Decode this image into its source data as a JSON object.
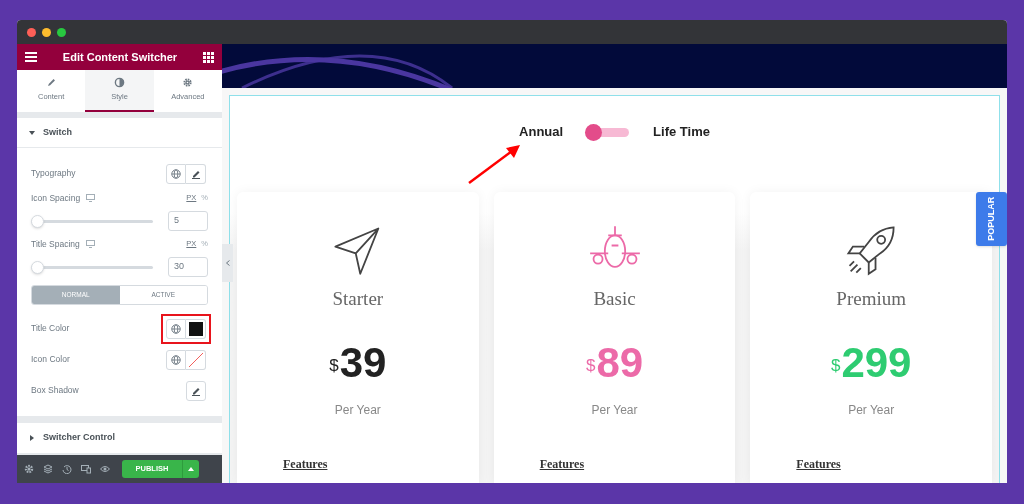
{
  "panel": {
    "title": "Edit Content Switcher",
    "tabs": [
      {
        "label": "Content",
        "selected": false
      },
      {
        "label": "Style",
        "selected": true
      },
      {
        "label": "Advanced",
        "selected": false
      }
    ],
    "sections": [
      {
        "title": "Switch",
        "expanded": true,
        "controls": [
          {
            "kind": "typography",
            "label": "Typography"
          },
          {
            "kind": "slider",
            "label": "Icon Spacing",
            "units": [
              "PX",
              "%"
            ],
            "level": 0,
            "value": "5"
          },
          {
            "kind": "slider",
            "label": "Title Spacing",
            "units": [
              "PX",
              "%"
            ],
            "level": 0,
            "value": "30"
          },
          {
            "kind": "state_tabs",
            "options": [
              {
                "label": "NORMAL",
                "selected": true
              },
              {
                "label": "ACTIVE",
                "selected": false
              }
            ]
          },
          {
            "kind": "color",
            "label": "Title Color",
            "color": "#111111",
            "highlighted": true
          },
          {
            "kind": "color",
            "label": "Icon Color",
            "highlighted": false
          },
          {
            "kind": "shadow",
            "label": "Box Shadow"
          }
        ]
      },
      {
        "title": "Switcher Control",
        "expanded": false
      }
    ],
    "publish": "PUBLISH"
  },
  "preview": {
    "switcher": {
      "left": "Annual",
      "right": "Life Time",
      "on": false
    },
    "annotation_arrow": true,
    "plans": [
      {
        "name": "Starter",
        "currency": "$",
        "price": "39",
        "color": "#222222",
        "period": "Per Year",
        "features": "Features"
      },
      {
        "name": "Basic",
        "currency": "$",
        "price": "89",
        "color": "#ec6aa8",
        "period": "Per Year",
        "features": "Features"
      },
      {
        "name": "Premium",
        "currency": "$",
        "price": "299",
        "color": "#2ecc71",
        "period": "Per Year",
        "features": "Features"
      }
    ],
    "badge": "POPULAR"
  }
}
